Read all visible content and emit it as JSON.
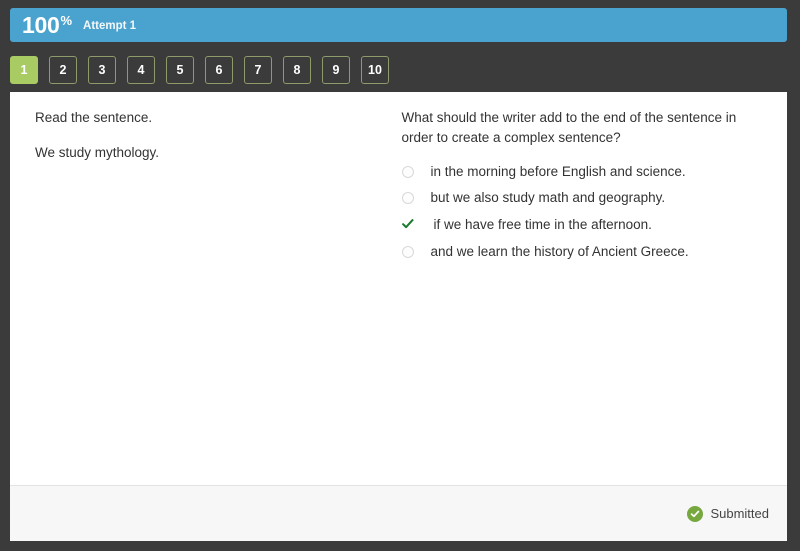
{
  "colors": {
    "frame": "#3b3b3b",
    "score_bar": "#4aa3cf",
    "active_nav": "#a8cc63",
    "nav_border": "#8d9b6a",
    "correct_check": "#1a7a2e",
    "submitted_badge": "#76a83f",
    "footer": "#f7f7f7",
    "text": "#333333"
  },
  "score_bar": {
    "value": "100",
    "percent_symbol": "%",
    "attempt_label": "Attempt 1"
  },
  "question_nav": {
    "items": [
      {
        "label": "1",
        "active": true
      },
      {
        "label": "2",
        "active": false
      },
      {
        "label": "3",
        "active": false
      },
      {
        "label": "4",
        "active": false
      },
      {
        "label": "5",
        "active": false
      },
      {
        "label": "6",
        "active": false
      },
      {
        "label": "7",
        "active": false
      },
      {
        "label": "8",
        "active": false
      },
      {
        "label": "9",
        "active": false
      },
      {
        "label": "10",
        "active": false
      }
    ]
  },
  "passage": {
    "instruction": "Read the sentence.",
    "sentence": "We study mythology."
  },
  "question": {
    "prompt": "What should the writer add to the end of the sentence in order to create a complex sentence?",
    "options": [
      {
        "label": "in the morning before English and science.",
        "selected": false,
        "correct": false
      },
      {
        "label": "but we also study math and geography.",
        "selected": false,
        "correct": false
      },
      {
        "label": "if we have free time in the afternoon.",
        "selected": true,
        "correct": true
      },
      {
        "label": "and we learn the history of Ancient Greece.",
        "selected": false,
        "correct": false
      }
    ]
  },
  "footer": {
    "status_text": "Submitted",
    "status_icon": "check-circle-icon"
  }
}
